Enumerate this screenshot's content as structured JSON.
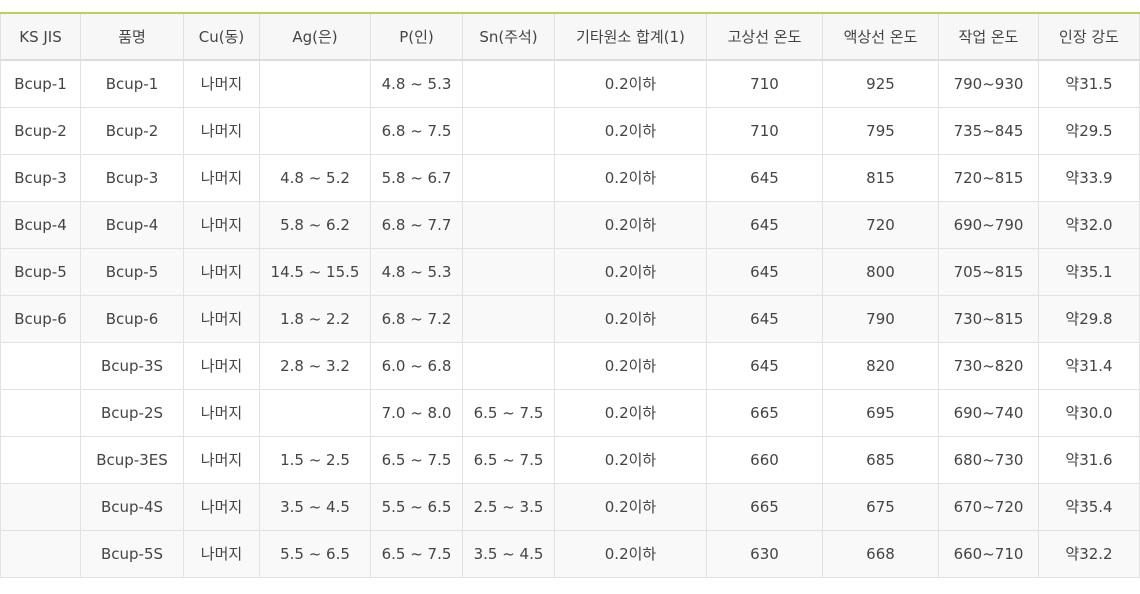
{
  "table": {
    "headers": [
      "KS JIS",
      "품명",
      "Cu(동)",
      "Ag(은)",
      "P(인)",
      "Sn(주석)",
      "기타원소 합계(1)",
      "고상선 온도",
      "액상선 온도",
      "작업 온도",
      "인장 강도"
    ],
    "rows": [
      [
        "Bcup-1",
        "Bcup-1",
        "나머지",
        "",
        "4.8 ~ 5.3",
        "",
        "0.2이하",
        "710",
        "925",
        "790~930",
        "약31.5"
      ],
      [
        "Bcup-2",
        "Bcup-2",
        "나머지",
        "",
        "6.8 ~ 7.5",
        "",
        "0.2이하",
        "710",
        "795",
        "735~845",
        "약29.5"
      ],
      [
        "Bcup-3",
        "Bcup-3",
        "나머지",
        "4.8 ~ 5.2",
        "5.8 ~ 6.7",
        "",
        "0.2이하",
        "645",
        "815",
        "720~815",
        "약33.9"
      ],
      [
        "Bcup-4",
        "Bcup-4",
        "나머지",
        "5.8 ~ 6.2",
        "6.8 ~ 7.7",
        "",
        "0.2이하",
        "645",
        "720",
        "690~790",
        "약32.0"
      ],
      [
        "Bcup-5",
        "Bcup-5",
        "나머지",
        "14.5 ~ 15.5",
        "4.8 ~ 5.3",
        "",
        "0.2이하",
        "645",
        "800",
        "705~815",
        "약35.1"
      ],
      [
        "Bcup-6",
        "Bcup-6",
        "나머지",
        "1.8 ~ 2.2",
        "6.8 ~ 7.2",
        "",
        "0.2이하",
        "645",
        "790",
        "730~815",
        "약29.8"
      ],
      [
        "",
        "Bcup-3S",
        "나머지",
        "2.8 ~ 3.2",
        "6.0 ~ 6.8",
        "",
        "0.2이하",
        "645",
        "820",
        "730~820",
        "약31.4"
      ],
      [
        "",
        "Bcup-2S",
        "나머지",
        "",
        "7.0 ~ 8.0",
        "6.5 ~ 7.5",
        "0.2이하",
        "665",
        "695",
        "690~740",
        "약30.0"
      ],
      [
        "",
        "Bcup-3ES",
        "나머지",
        "1.5 ~ 2.5",
        "6.5 ~ 7.5",
        "6.5 ~ 7.5",
        "0.2이하",
        "660",
        "685",
        "680~730",
        "약31.6"
      ],
      [
        "",
        "Bcup-4S",
        "나머지",
        "3.5 ~ 4.5",
        "5.5 ~ 6.5",
        "2.5 ~ 3.5",
        "0.2이하",
        "665",
        "675",
        "670~720",
        "약35.4"
      ],
      [
        "",
        "Bcup-5S",
        "나머지",
        "5.5 ~ 6.5",
        "6.5 ~ 7.5",
        "3.5 ~ 4.5",
        "0.2이하",
        "630",
        "668",
        "660~710",
        "약32.2"
      ]
    ],
    "shaded_rows": [
      3,
      4,
      5,
      9,
      10
    ],
    "colors": {
      "header_top_border": "#b7d256",
      "header_bg": "#f7f7f7",
      "shaded_row_bg": "#f9f9f9",
      "grid_line": "#e2e2e2",
      "text": "#444444"
    }
  }
}
